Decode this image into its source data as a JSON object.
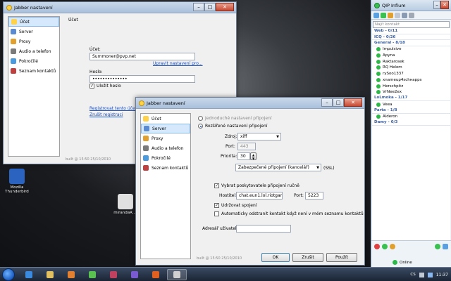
{
  "desktop": {
    "icons": [
      {
        "label": "Mozilla Thunderbird",
        "color": "#2a64c0"
      },
      {
        "label": "mirandaR....",
        "color": "#e0e0e0"
      }
    ]
  },
  "window1": {
    "title": "Jabber nastavení",
    "nav": [
      "Účet",
      "Server",
      "Proxy",
      "Audio a telefon",
      "Pokročilé",
      "Seznam kontaktů"
    ],
    "section": "Účet",
    "account_label": "Účet:",
    "account_value": "Summoner@pvp.net",
    "edit_link": "Upravit nastavení pro...",
    "password_label": "Heslo:",
    "password_value": "••••••••••••••",
    "save_password": "Uložit heslo",
    "register_link": "Registrovat tento účet...",
    "cancel_reg_link": "Zrušit registraci",
    "build": "built @ 15:50 25/10/2010"
  },
  "window2": {
    "title": "Jabber nastavení",
    "nav": [
      "Účet",
      "Server",
      "Proxy",
      "Audio a telefon",
      "Pokročilé",
      "Seznam kontaktů"
    ],
    "radio_simple": "Jednoduché nastavení připojení",
    "radio_advanced": "Rozšířené nastavení připojení",
    "source_label": "Zdroj:",
    "source_value": "xiff",
    "port_label": "Port:",
    "port_value": "443",
    "priority_label": "Priorita:",
    "priority_value": "30",
    "security_value": "Zabezpečené připojení (kancelář)",
    "ssl_label": "(SSL)",
    "manual_host": "Vybrat poskytovatele připojení ručně",
    "host_label": "Hostitel:",
    "host_value": "chat.eun1.lol.riotgames.cc",
    "port2_label": "Port:",
    "port2_value": "5223",
    "keep_alive": "Udržovat spojení",
    "auto_remove": "Automaticky odstranit kontakt když není v mém seznamu kontaktů",
    "user_addr_label": "Adresář uživatele:",
    "build": "built @ 15:50 25/10/2010",
    "ok": "OK",
    "cancel": "Zrušit",
    "apply": "Použít"
  },
  "qip": {
    "title": "QIP Infium",
    "search_placeholder": "Najít kontakt",
    "rows": [
      {
        "kind": "grp",
        "text": "Web - 0/11"
      },
      {
        "kind": "grp",
        "text": "ICQ - 0/26"
      },
      {
        "kind": "grp",
        "text": "General - 8/18"
      },
      {
        "kind": "ct",
        "text": "Impulsive"
      },
      {
        "kind": "ct",
        "text": "Apyna"
      },
      {
        "kind": "ct",
        "text": "Raktarosek"
      },
      {
        "kind": "ct",
        "text": "RQ Helom"
      },
      {
        "kind": "ct",
        "text": "rySoo1337"
      },
      {
        "kind": "ct",
        "text": "xnameup4schнapps"
      },
      {
        "kind": "ct",
        "text": "Herschpitz"
      },
      {
        "kind": "ct",
        "text": "VrNee2ex"
      },
      {
        "kind": "grp",
        "text": "LoLmoka - 1/17"
      },
      {
        "kind": "ct",
        "text": "Veea"
      },
      {
        "kind": "grp",
        "text": "Parta - 1/8"
      },
      {
        "kind": "ct",
        "text": "Alderon"
      },
      {
        "kind": "grp",
        "text": "Damy - 0/3"
      }
    ],
    "status": "Online"
  },
  "taskbar": {
    "lang": "CS",
    "time": "11:37"
  },
  "colors": {
    "selection": "#d6e8fc",
    "link": "#1a4fc4",
    "online": "#2eb84a"
  }
}
